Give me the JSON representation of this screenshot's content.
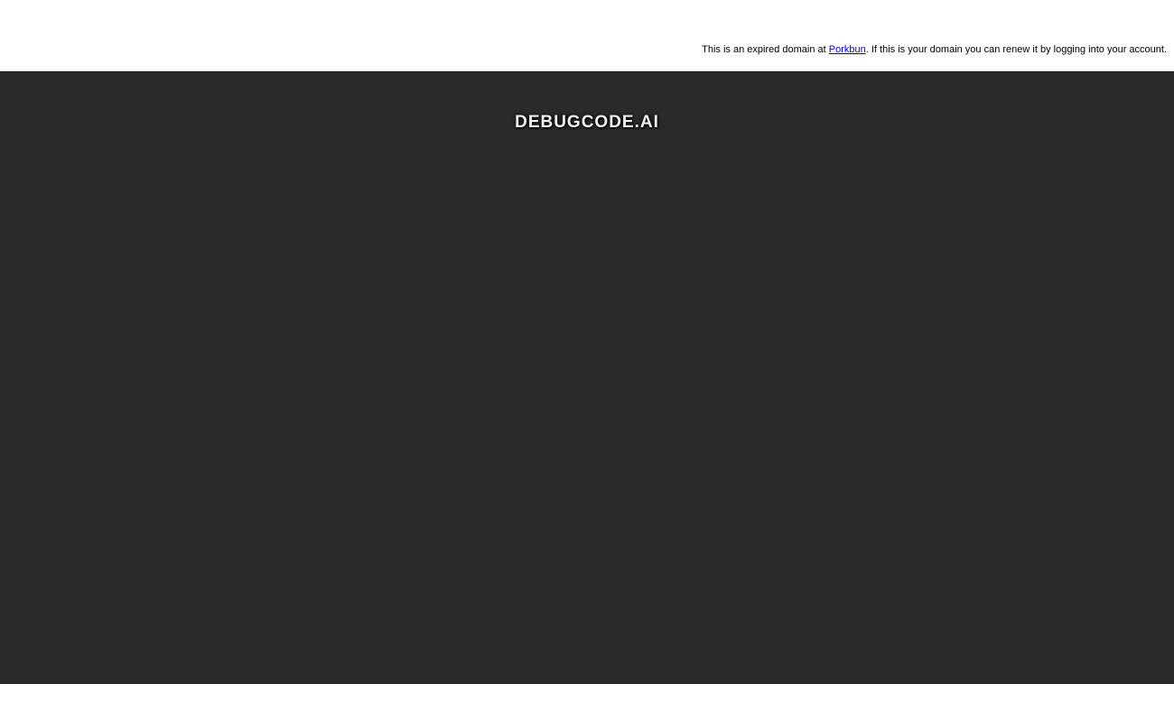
{
  "notice": {
    "prefix": "This is an expired domain at ",
    "link_text": "Porkbun",
    "suffix": ". If this is your domain you can renew it by logging into your account."
  },
  "domain": {
    "name": "DEBUGCODE.AI"
  },
  "colors": {
    "panel_background": "#2a2a2a",
    "link": "#0000ee",
    "title_text": "#f2f2f2"
  }
}
